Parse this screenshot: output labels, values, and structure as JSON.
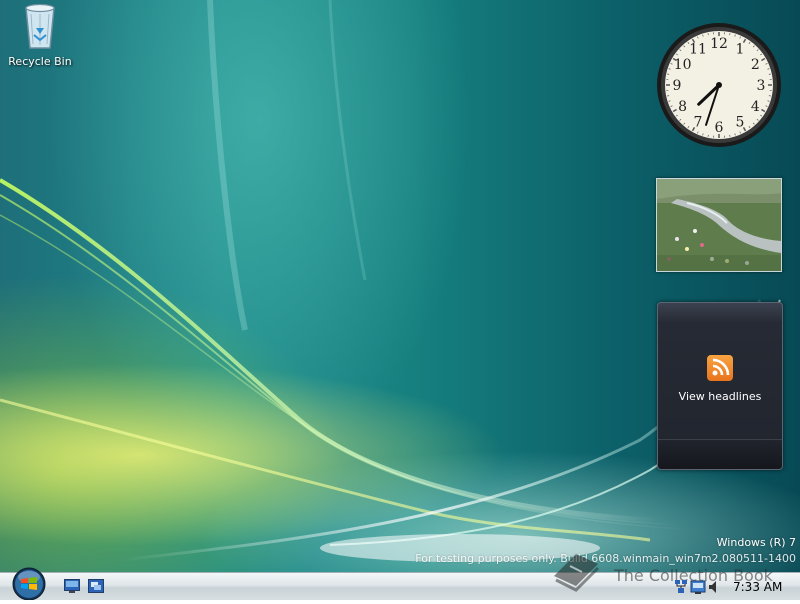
{
  "desktop": {
    "icons": [
      {
        "label": "Recycle Bin",
        "icon": "recycle-bin-icon"
      }
    ]
  },
  "gadgets": {
    "clock": {
      "numerals": [
        "12",
        "1",
        "2",
        "3",
        "4",
        "5",
        "6",
        "7",
        "8",
        "9",
        "10",
        "11"
      ],
      "hour": 7,
      "minute": 33
    },
    "slideshow": {
      "subject": "mountain stream meadow"
    },
    "feed": {
      "label": "View headlines",
      "icon": "rss-icon"
    }
  },
  "watermark": {
    "line1": "Windows (R) 7",
    "line2": "For testing purposes only. Build 6608.winmain_win7m2.080511-1400"
  },
  "brand": {
    "text": "The Collection Book",
    "icon": "book-icon"
  },
  "taskbar": {
    "start": {
      "icon": "windows-start-orb-icon"
    },
    "quick_launch": [
      {
        "icon": "show-desktop-icon"
      },
      {
        "icon": "switch-windows-icon"
      }
    ],
    "tray": {
      "icons": [
        "network-icon",
        "action-center-icon",
        "volume-icon"
      ],
      "time": "7:33 AM"
    }
  },
  "colors": {
    "desktop_teal": "#1f8a8a",
    "desktop_yellow": "#fff878",
    "desktop_green": "#aadc28",
    "taskbar_light": "#dfe6e9",
    "feed_bg": "#22262f",
    "rss_orange": "#e8741d"
  }
}
